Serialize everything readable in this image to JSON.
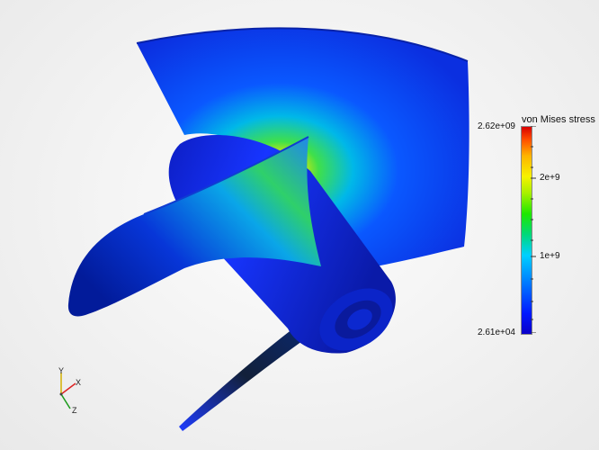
{
  "legend": {
    "title": "von Mises stress",
    "max_label": "2.62e+09",
    "tick_2e9": "2e+9",
    "tick_1e9": "1e+9",
    "min_label": "2.61e+04"
  },
  "axes": {
    "x_label": "X",
    "y_label": "Y",
    "z_label": "Z"
  },
  "colors": {
    "background": "#f1f1f1",
    "stress_low": "#0019ff",
    "stress_mid": "#1ee800",
    "stress_high": "#d80000"
  }
}
